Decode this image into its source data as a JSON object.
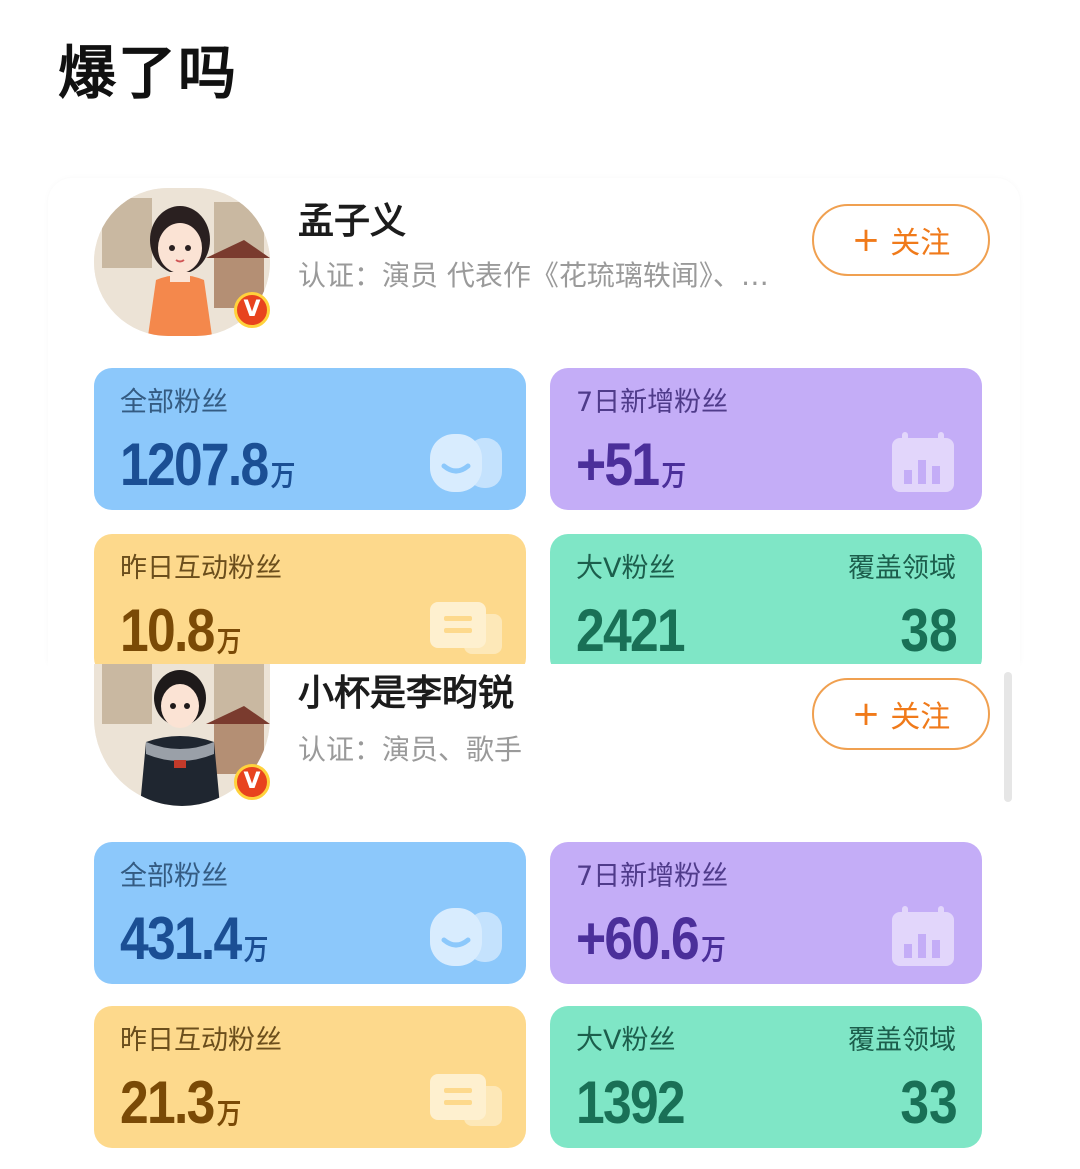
{
  "post": {
    "title": "爆了吗"
  },
  "follow_label": "关注",
  "profiles": [
    {
      "name": "孟子义",
      "verification": "认证：演员 代表作《花琉璃轶闻》、…",
      "badge": "V",
      "stats": {
        "total_fans": {
          "label": "全部粉丝",
          "value": "1207.8",
          "unit": "万"
        },
        "new_fans_7d": {
          "label": "7日新增粉丝",
          "value": "+51",
          "unit": "万"
        },
        "interactive_fans_yesterday": {
          "label": "昨日互动粉丝",
          "value": "10.8",
          "unit": "万"
        },
        "big_v_fans": {
          "label": "大V粉丝",
          "value": "2421"
        },
        "coverage_fields": {
          "label": "覆盖领域",
          "value": "38"
        }
      }
    },
    {
      "name": "小杯是李昀锐",
      "verification": "认证：演员、歌手",
      "badge": "V",
      "stats": {
        "total_fans": {
          "label": "全部粉丝",
          "value": "431.4",
          "unit": "万"
        },
        "new_fans_7d": {
          "label": "7日新增粉丝",
          "value": "+60.6",
          "unit": "万"
        },
        "interactive_fans_yesterday": {
          "label": "昨日互动粉丝",
          "value": "21.3",
          "unit": "万"
        },
        "big_v_fans": {
          "label": "大V粉丝",
          "value": "1392"
        },
        "coverage_fields": {
          "label": "覆盖领域",
          "value": "33"
        }
      }
    }
  ],
  "colors": {
    "blue_tile": "#8cc8fb",
    "purple_tile": "#c4adf7",
    "yellow_tile": "#fdd98c",
    "green_tile": "#7fe6c6",
    "follow_accent": "#f07a1a",
    "verified_badge": "#e8431e"
  },
  "icons": {
    "total_fans": "people-icon",
    "new_fans_7d": "calendar-chart-icon",
    "interactive_fans_yesterday": "chat-bubble-icon",
    "follow": "plus-icon"
  }
}
